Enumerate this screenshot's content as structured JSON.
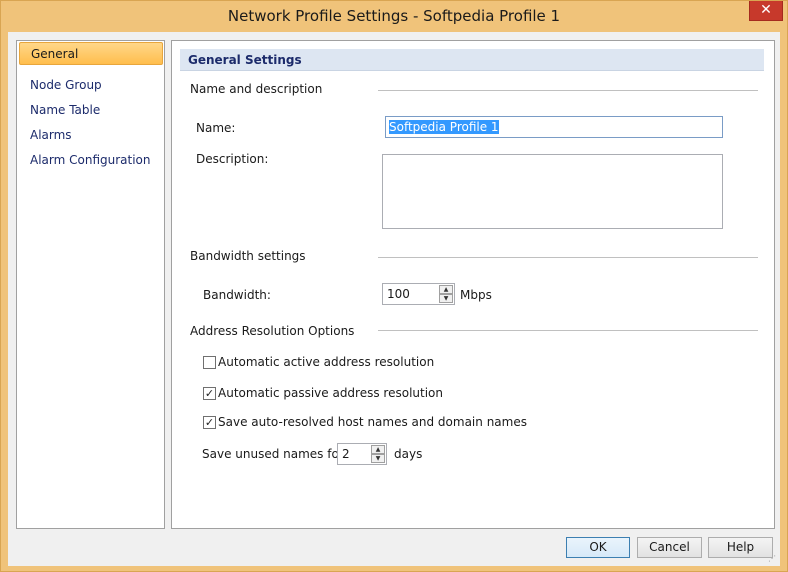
{
  "window": {
    "title": "Network Profile Settings - Softpedia Profile 1",
    "close_glyph": "✕"
  },
  "nav": {
    "items": [
      {
        "label": "General",
        "active": true
      },
      {
        "label": "Node Group"
      },
      {
        "label": "Name Table"
      },
      {
        "label": "Alarms"
      },
      {
        "label": "Alarm Configuration"
      }
    ]
  },
  "panel": {
    "header": "General Settings",
    "name_desc": {
      "group_label": "Name and description",
      "name_label": "Name:",
      "name_value": "Softpedia Profile 1",
      "description_label": "Description:",
      "description_value": ""
    },
    "bandwidth": {
      "group_label": "Bandwidth settings",
      "label": "Bandwidth:",
      "value": "100",
      "unit": "Mbps"
    },
    "address": {
      "group_label": "Address Resolution Options",
      "options": [
        {
          "label": "Automatic active address resolution",
          "checked": false
        },
        {
          "label": "Automatic passive address resolution",
          "checked": true
        },
        {
          "label": "Save auto-resolved host names and domain names",
          "checked": true
        }
      ],
      "save_unused_label": "Save unused names for:",
      "save_unused_value": "2",
      "save_unused_unit": "days"
    }
  },
  "buttons": {
    "ok": "OK",
    "cancel": "Cancel",
    "help": "Help"
  },
  "glyphs": {
    "check": "✓",
    "spin_up": "▲",
    "spin_down": "▼"
  },
  "colors": {
    "frame": "#f0c37a",
    "nav_active": "#ffbe4d",
    "header_bg": "#dde6f2",
    "selection": "#3399ff"
  }
}
